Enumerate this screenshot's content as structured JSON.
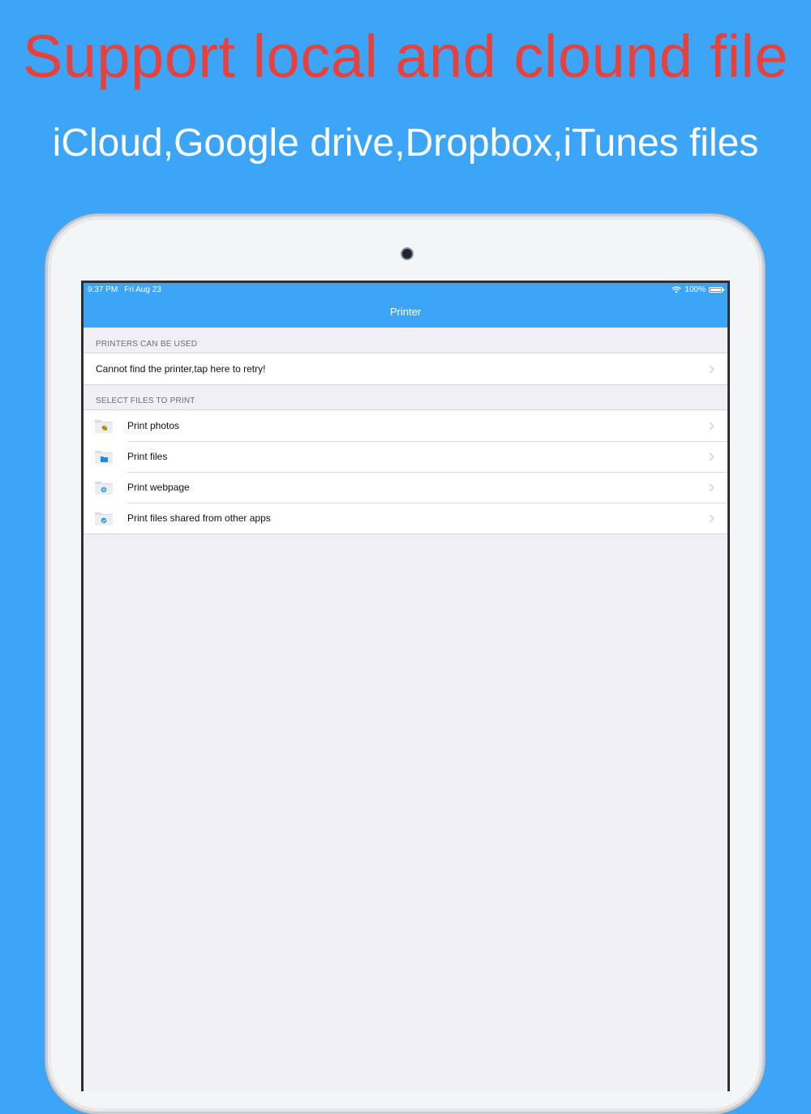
{
  "headline": "Support local and clound file",
  "subheadline": "iCloud,Google drive,Dropbox,iTunes files",
  "status_bar": {
    "time": "9:37 PM",
    "date": "Fri Aug 23",
    "battery": "100%"
  },
  "nav": {
    "title": "Printer"
  },
  "printers_section": {
    "header": "PRINTERS CAN BE USED",
    "items": [
      {
        "label": "Cannot find the printer,tap here to retry!"
      }
    ]
  },
  "files_section": {
    "header": "SELECT FILES TO PRINT",
    "items": [
      {
        "label": "Print photos",
        "icon": "photos-folder-icon"
      },
      {
        "label": "Print files",
        "icon": "files-folder-icon"
      },
      {
        "label": "Print webpage",
        "icon": "webpage-folder-icon"
      },
      {
        "label": "Print files shared from other apps",
        "icon": "shared-folder-icon"
      }
    ]
  },
  "colors": {
    "background": "#3ca5f7",
    "headline": "#e8413b",
    "navbar": "#3ca5f7",
    "table_background": "#efeff4"
  }
}
